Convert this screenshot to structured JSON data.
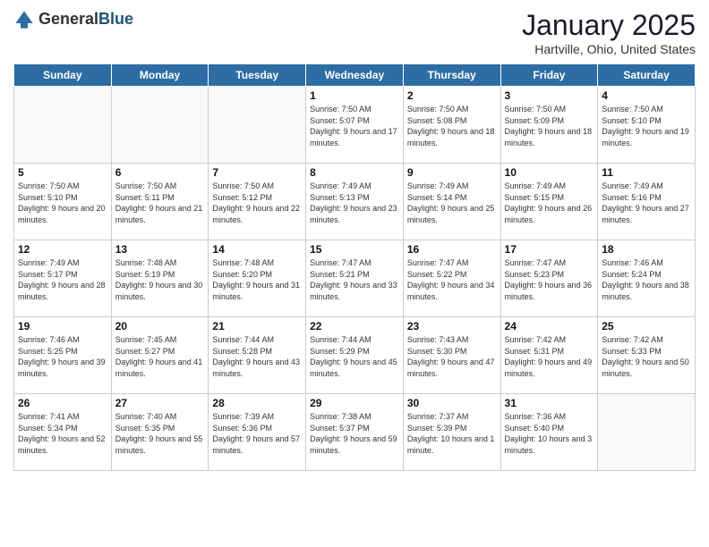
{
  "header": {
    "logo_general": "General",
    "logo_blue": "Blue",
    "month_title": "January 2025",
    "subtitle": "Hartville, Ohio, United States"
  },
  "days_of_week": [
    "Sunday",
    "Monday",
    "Tuesday",
    "Wednesday",
    "Thursday",
    "Friday",
    "Saturday"
  ],
  "weeks": [
    [
      {
        "day": "",
        "sunrise": "",
        "sunset": "",
        "daylight": ""
      },
      {
        "day": "",
        "sunrise": "",
        "sunset": "",
        "daylight": ""
      },
      {
        "day": "",
        "sunrise": "",
        "sunset": "",
        "daylight": ""
      },
      {
        "day": "1",
        "sunrise": "Sunrise: 7:50 AM",
        "sunset": "Sunset: 5:07 PM",
        "daylight": "Daylight: 9 hours and 17 minutes."
      },
      {
        "day": "2",
        "sunrise": "Sunrise: 7:50 AM",
        "sunset": "Sunset: 5:08 PM",
        "daylight": "Daylight: 9 hours and 18 minutes."
      },
      {
        "day": "3",
        "sunrise": "Sunrise: 7:50 AM",
        "sunset": "Sunset: 5:09 PM",
        "daylight": "Daylight: 9 hours and 18 minutes."
      },
      {
        "day": "4",
        "sunrise": "Sunrise: 7:50 AM",
        "sunset": "Sunset: 5:10 PM",
        "daylight": "Daylight: 9 hours and 19 minutes."
      }
    ],
    [
      {
        "day": "5",
        "sunrise": "Sunrise: 7:50 AM",
        "sunset": "Sunset: 5:10 PM",
        "daylight": "Daylight: 9 hours and 20 minutes."
      },
      {
        "day": "6",
        "sunrise": "Sunrise: 7:50 AM",
        "sunset": "Sunset: 5:11 PM",
        "daylight": "Daylight: 9 hours and 21 minutes."
      },
      {
        "day": "7",
        "sunrise": "Sunrise: 7:50 AM",
        "sunset": "Sunset: 5:12 PM",
        "daylight": "Daylight: 9 hours and 22 minutes."
      },
      {
        "day": "8",
        "sunrise": "Sunrise: 7:49 AM",
        "sunset": "Sunset: 5:13 PM",
        "daylight": "Daylight: 9 hours and 23 minutes."
      },
      {
        "day": "9",
        "sunrise": "Sunrise: 7:49 AM",
        "sunset": "Sunset: 5:14 PM",
        "daylight": "Daylight: 9 hours and 25 minutes."
      },
      {
        "day": "10",
        "sunrise": "Sunrise: 7:49 AM",
        "sunset": "Sunset: 5:15 PM",
        "daylight": "Daylight: 9 hours and 26 minutes."
      },
      {
        "day": "11",
        "sunrise": "Sunrise: 7:49 AM",
        "sunset": "Sunset: 5:16 PM",
        "daylight": "Daylight: 9 hours and 27 minutes."
      }
    ],
    [
      {
        "day": "12",
        "sunrise": "Sunrise: 7:49 AM",
        "sunset": "Sunset: 5:17 PM",
        "daylight": "Daylight: 9 hours and 28 minutes."
      },
      {
        "day": "13",
        "sunrise": "Sunrise: 7:48 AM",
        "sunset": "Sunset: 5:19 PM",
        "daylight": "Daylight: 9 hours and 30 minutes."
      },
      {
        "day": "14",
        "sunrise": "Sunrise: 7:48 AM",
        "sunset": "Sunset: 5:20 PM",
        "daylight": "Daylight: 9 hours and 31 minutes."
      },
      {
        "day": "15",
        "sunrise": "Sunrise: 7:47 AM",
        "sunset": "Sunset: 5:21 PM",
        "daylight": "Daylight: 9 hours and 33 minutes."
      },
      {
        "day": "16",
        "sunrise": "Sunrise: 7:47 AM",
        "sunset": "Sunset: 5:22 PM",
        "daylight": "Daylight: 9 hours and 34 minutes."
      },
      {
        "day": "17",
        "sunrise": "Sunrise: 7:47 AM",
        "sunset": "Sunset: 5:23 PM",
        "daylight": "Daylight: 9 hours and 36 minutes."
      },
      {
        "day": "18",
        "sunrise": "Sunrise: 7:46 AM",
        "sunset": "Sunset: 5:24 PM",
        "daylight": "Daylight: 9 hours and 38 minutes."
      }
    ],
    [
      {
        "day": "19",
        "sunrise": "Sunrise: 7:46 AM",
        "sunset": "Sunset: 5:25 PM",
        "daylight": "Daylight: 9 hours and 39 minutes."
      },
      {
        "day": "20",
        "sunrise": "Sunrise: 7:45 AM",
        "sunset": "Sunset: 5:27 PM",
        "daylight": "Daylight: 9 hours and 41 minutes."
      },
      {
        "day": "21",
        "sunrise": "Sunrise: 7:44 AM",
        "sunset": "Sunset: 5:28 PM",
        "daylight": "Daylight: 9 hours and 43 minutes."
      },
      {
        "day": "22",
        "sunrise": "Sunrise: 7:44 AM",
        "sunset": "Sunset: 5:29 PM",
        "daylight": "Daylight: 9 hours and 45 minutes."
      },
      {
        "day": "23",
        "sunrise": "Sunrise: 7:43 AM",
        "sunset": "Sunset: 5:30 PM",
        "daylight": "Daylight: 9 hours and 47 minutes."
      },
      {
        "day": "24",
        "sunrise": "Sunrise: 7:42 AM",
        "sunset": "Sunset: 5:31 PM",
        "daylight": "Daylight: 9 hours and 49 minutes."
      },
      {
        "day": "25",
        "sunrise": "Sunrise: 7:42 AM",
        "sunset": "Sunset: 5:33 PM",
        "daylight": "Daylight: 9 hours and 50 minutes."
      }
    ],
    [
      {
        "day": "26",
        "sunrise": "Sunrise: 7:41 AM",
        "sunset": "Sunset: 5:34 PM",
        "daylight": "Daylight: 9 hours and 52 minutes."
      },
      {
        "day": "27",
        "sunrise": "Sunrise: 7:40 AM",
        "sunset": "Sunset: 5:35 PM",
        "daylight": "Daylight: 9 hours and 55 minutes."
      },
      {
        "day": "28",
        "sunrise": "Sunrise: 7:39 AM",
        "sunset": "Sunset: 5:36 PM",
        "daylight": "Daylight: 9 hours and 57 minutes."
      },
      {
        "day": "29",
        "sunrise": "Sunrise: 7:38 AM",
        "sunset": "Sunset: 5:37 PM",
        "daylight": "Daylight: 9 hours and 59 minutes."
      },
      {
        "day": "30",
        "sunrise": "Sunrise: 7:37 AM",
        "sunset": "Sunset: 5:39 PM",
        "daylight": "Daylight: 10 hours and 1 minute."
      },
      {
        "day": "31",
        "sunrise": "Sunrise: 7:36 AM",
        "sunset": "Sunset: 5:40 PM",
        "daylight": "Daylight: 10 hours and 3 minutes."
      },
      {
        "day": "",
        "sunrise": "",
        "sunset": "",
        "daylight": ""
      }
    ]
  ]
}
